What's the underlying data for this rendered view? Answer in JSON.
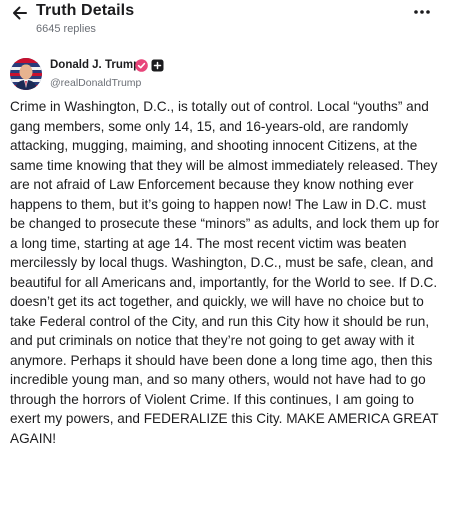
{
  "header": {
    "back_icon": "arrow-left-icon",
    "title": "Truth Details",
    "replies": "6645 replies",
    "more_icon": "more-horizontal-icon"
  },
  "author": {
    "name": "Donald J. Trump",
    "handle": "@realDonaldTrump",
    "verified_icon": "verified-badge-icon",
    "verified_color": "#e8457a",
    "follow_icon": "follow-square-icon"
  },
  "post": {
    "text": "Crime in Washington, D.C., is totally out of control. Local “youths” and gang members, some only 14, 15, and 16-years-old, are randomly attacking, mugging, maiming, and shooting innocent Citizens, at the same time knowing that they will be almost immediately released. They are not afraid of Law Enforcement because they know nothing ever happens to them, but it’s going to happen now! The Law in D.C. must be changed to prosecute these “minors” as adults, and lock them up for a long time, starting at age 14. The most recent victim was beaten mercilessly by local thugs. Washington, D.C., must be safe, clean, and beautiful for all Americans and, importantly, for the World to see. If D.C. doesn’t get its act together, and quickly, we will have no choice but to take Federal control of the City, and run this City how it should be run, and put criminals on notice that they’re not going to get away with it anymore. Perhaps it should have been done a long time ago, then this incredible young man, and so many others, would not have had to go through the horrors of Violent Crime. If this continues, I am going to exert my powers, and FEDERALIZE this City. MAKE AMERICA GREAT AGAIN!"
  }
}
